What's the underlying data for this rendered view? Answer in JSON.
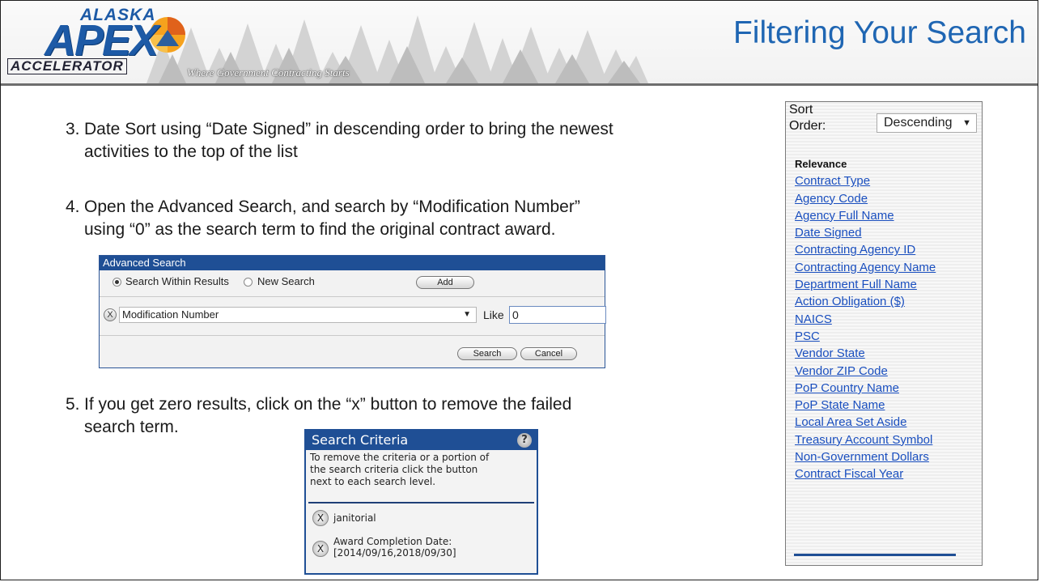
{
  "header": {
    "logo_alaska": "ALASKA",
    "logo_apex": "APEX",
    "logo_accelerator": "ACCELERATOR",
    "tagline": "Where Government Contracting Starts",
    "title": "Filtering Your Search"
  },
  "steps": [
    {
      "num": "3.",
      "line1": "Date Sort using “Date Signed” in descending order to bring the newest",
      "line2": "activities to the top of the list"
    },
    {
      "num": "4.",
      "line1": "Open the Advanced Search, and search by “Modification Number”",
      "line2": "using “0” as the search term to find the original contract award."
    },
    {
      "num": "5.",
      "line1": "If you get zero results, click on the “x” button to remove the failed",
      "line2": "search term."
    }
  ],
  "advanced_search": {
    "title": "Advanced Search",
    "radio_within": "Search Within Results",
    "radio_new": "New Search",
    "selected_radio": "Search Within Results",
    "add_label": "Add",
    "field_select": "Modification Number",
    "operator": "Like",
    "term_value": "0",
    "search_label": "Search",
    "cancel_label": "Cancel",
    "x_label": "X"
  },
  "search_criteria": {
    "title": "Search Criteria",
    "help": "?",
    "description_lines": [
      "To remove the criteria or a portion of",
      "the search criteria click the button",
      "next to each search level."
    ],
    "items": [
      {
        "line1": "janitorial",
        "line2": ""
      },
      {
        "line1": "Award Completion Date:",
        "line2": "[2014/09/16,2018/09/30]"
      }
    ],
    "x_label": "X"
  },
  "sort_panel": {
    "label_line1": "Sort",
    "label_line2": "Order:",
    "order_value": "Descending",
    "current": "Relevance",
    "options": [
      "Contract Type",
      "Agency Code",
      "Agency Full Name",
      "Date Signed",
      "Contracting Agency ID",
      "Contracting Agency Name",
      "Department Full Name",
      "Action Obligation ($)",
      "NAICS",
      "PSC",
      "Vendor State",
      "Vendor ZIP Code",
      "PoP Country Name",
      "PoP State Name",
      "Local Area Set Aside",
      "Treasury Account Symbol",
      "Non-Government Dollars",
      "Contract Fiscal Year"
    ]
  },
  "colors": {
    "title_blue": "#1f66b3",
    "panel_blue": "#1f4f95",
    "link_blue": "#1a4fbf"
  }
}
